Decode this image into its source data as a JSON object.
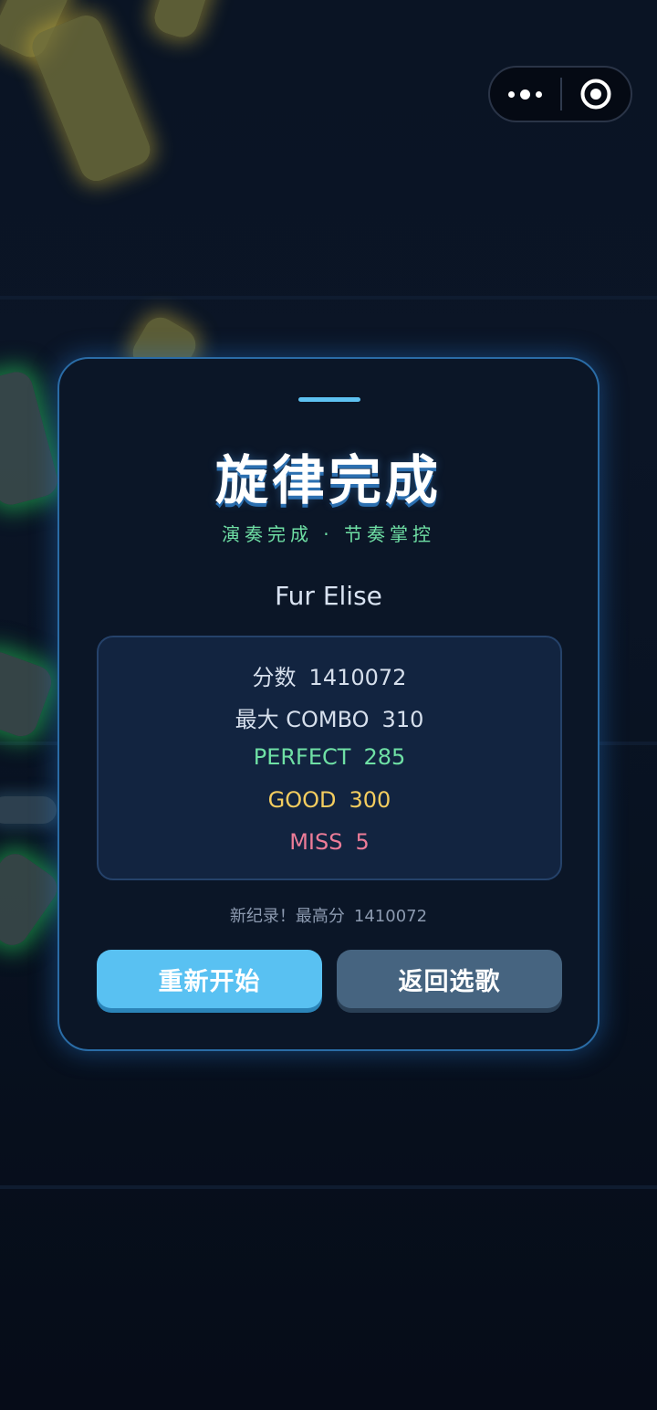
{
  "capsule": {
    "more_icon": "more-dots-icon",
    "close_icon": "target-circle-icon"
  },
  "result": {
    "title": "旋律完成",
    "subtitle": "演奏完成 · 节奏掌控",
    "song_name": "Fur Elise",
    "stats": {
      "score_label": "分数",
      "score_value": "1410072",
      "combo_label": "最大 COMBO",
      "combo_value": "310",
      "perfect_label": "PERFECT",
      "perfect_value": "285",
      "good_label": "GOOD",
      "good_value": "300",
      "miss_label": "MISS",
      "miss_value": "5"
    },
    "record_label": "新纪录！最高分",
    "record_value": "1410072",
    "restart_label": "重新开始",
    "back_label": "返回选歌"
  },
  "colors": {
    "accent": "#5ec2f2",
    "perfect": "#6fe0a5",
    "good": "#f4cd5f",
    "miss": "#ec7c98",
    "primary_button": "#59c1f2",
    "secondary_button": "#466480"
  }
}
